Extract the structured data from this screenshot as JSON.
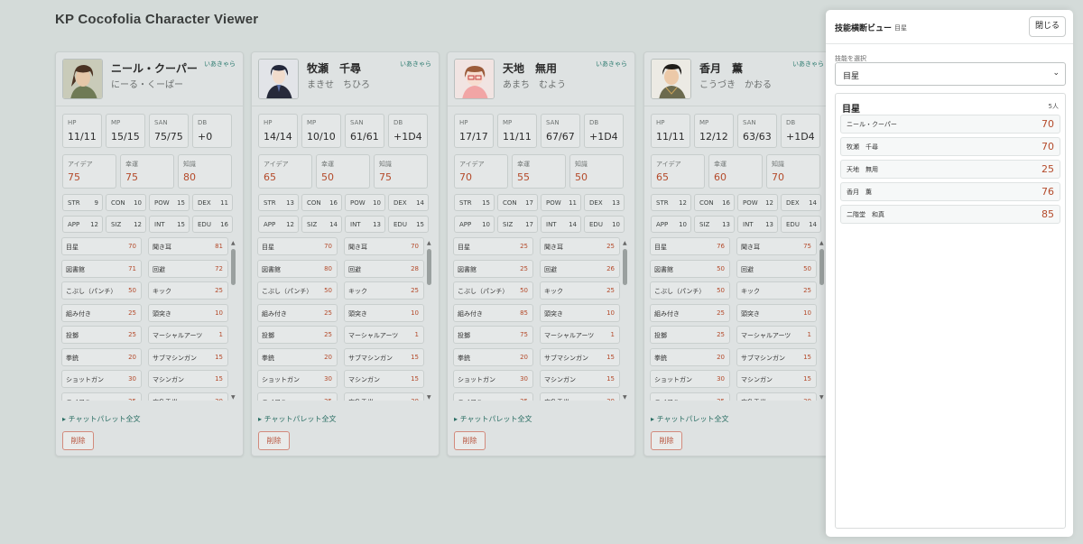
{
  "app": {
    "title": "KP Cocofolia Character Viewer"
  },
  "labels": {
    "hp": "HP",
    "mp": "MP",
    "san": "SAN",
    "db": "DB",
    "idea": "アイデア",
    "luck": "幸運",
    "know": "知識",
    "chat_palette": "チャットパレット全文",
    "delete": "削除"
  },
  "characters": [
    {
      "name": "ニール・クーパー",
      "kana": "にーる・くーぱー",
      "owner": "いあきゃら",
      "hp": "11/11",
      "mp": "15/15",
      "san": "75/75",
      "db": "+0",
      "idea": "75",
      "luck": "75",
      "know": "80",
      "attrs": [
        [
          "STR",
          "9"
        ],
        [
          "CON",
          "10"
        ],
        [
          "POW",
          "15"
        ],
        [
          "DEX",
          "11"
        ],
        [
          "APP",
          "12"
        ],
        [
          "SIZ",
          "12"
        ],
        [
          "INT",
          "15"
        ],
        [
          "EDU",
          "16"
        ]
      ],
      "skills": [
        [
          "目星",
          "70"
        ],
        [
          "聞き耳",
          "81"
        ],
        [
          "図書館",
          "71"
        ],
        [
          "回避",
          "72"
        ],
        [
          "こぶし（パンチ）",
          "50"
        ],
        [
          "キック",
          "25"
        ],
        [
          "組み付き",
          "25"
        ],
        [
          "頭突き",
          "10"
        ],
        [
          "投擲",
          "25"
        ],
        [
          "マーシャルアーツ",
          "1"
        ],
        [
          "拳銃",
          "20"
        ],
        [
          "サブマシンガン",
          "15"
        ],
        [
          "ショットガン",
          "30"
        ],
        [
          "マシンガン",
          "15"
        ],
        [
          "ライフル",
          "25"
        ],
        [
          "応急手当",
          "30"
        ]
      ]
    },
    {
      "name": "牧瀬　千尋",
      "kana": "まきせ　ちひろ",
      "owner": "いあきゃら",
      "hp": "14/14",
      "mp": "10/10",
      "san": "61/61",
      "db": "+1D4",
      "idea": "65",
      "luck": "50",
      "know": "75",
      "attrs": [
        [
          "STR",
          "13"
        ],
        [
          "CON",
          "16"
        ],
        [
          "POW",
          "10"
        ],
        [
          "DEX",
          "14"
        ],
        [
          "APP",
          "12"
        ],
        [
          "SIZ",
          "14"
        ],
        [
          "INT",
          "13"
        ],
        [
          "EDU",
          "15"
        ]
      ],
      "skills": [
        [
          "目星",
          "70"
        ],
        [
          "聞き耳",
          "70"
        ],
        [
          "図書館",
          "80"
        ],
        [
          "回避",
          "28"
        ],
        [
          "こぶし（パンチ）",
          "50"
        ],
        [
          "キック",
          "25"
        ],
        [
          "組み付き",
          "25"
        ],
        [
          "頭突き",
          "10"
        ],
        [
          "投擲",
          "25"
        ],
        [
          "マーシャルアーツ",
          "1"
        ],
        [
          "拳銃",
          "20"
        ],
        [
          "サブマシンガン",
          "15"
        ],
        [
          "ショットガン",
          "30"
        ],
        [
          "マシンガン",
          "15"
        ],
        [
          "ライフル",
          "25"
        ],
        [
          "応急手当",
          "30"
        ]
      ]
    },
    {
      "name": "天地　無用",
      "kana": "あまち　むよう",
      "owner": "いあきゃら",
      "hp": "17/17",
      "mp": "11/11",
      "san": "67/67",
      "db": "+1D4",
      "idea": "70",
      "luck": "55",
      "know": "50",
      "attrs": [
        [
          "STR",
          "15"
        ],
        [
          "CON",
          "17"
        ],
        [
          "POW",
          "11"
        ],
        [
          "DEX",
          "13"
        ],
        [
          "APP",
          "10"
        ],
        [
          "SIZ",
          "17"
        ],
        [
          "INT",
          "14"
        ],
        [
          "EDU",
          "10"
        ]
      ],
      "skills": [
        [
          "目星",
          "25"
        ],
        [
          "聞き耳",
          "25"
        ],
        [
          "図書館",
          "25"
        ],
        [
          "回避",
          "26"
        ],
        [
          "こぶし（パンチ）",
          "50"
        ],
        [
          "キック",
          "25"
        ],
        [
          "組み付き",
          "85"
        ],
        [
          "頭突き",
          "10"
        ],
        [
          "投擲",
          "75"
        ],
        [
          "マーシャルアーツ",
          "1"
        ],
        [
          "拳銃",
          "20"
        ],
        [
          "サブマシンガン",
          "15"
        ],
        [
          "ショットガン",
          "30"
        ],
        [
          "マシンガン",
          "15"
        ],
        [
          "ライフル",
          "25"
        ],
        [
          "応急手当",
          "30"
        ]
      ]
    },
    {
      "name": "香月　薫",
      "kana": "こうづき　かおる",
      "owner": "いあきゃら",
      "hp": "11/11",
      "mp": "12/12",
      "san": "63/63",
      "db": "+1D4",
      "idea": "65",
      "luck": "60",
      "know": "70",
      "attrs": [
        [
          "STR",
          "12"
        ],
        [
          "CON",
          "16"
        ],
        [
          "POW",
          "12"
        ],
        [
          "DEX",
          "14"
        ],
        [
          "APP",
          "10"
        ],
        [
          "SIZ",
          "13"
        ],
        [
          "INT",
          "13"
        ],
        [
          "EDU",
          "14"
        ]
      ],
      "skills": [
        [
          "目星",
          "76"
        ],
        [
          "聞き耳",
          "75"
        ],
        [
          "図書館",
          "50"
        ],
        [
          "回避",
          "50"
        ],
        [
          "こぶし（パンチ）",
          "50"
        ],
        [
          "キック",
          "25"
        ],
        [
          "組み付き",
          "25"
        ],
        [
          "頭突き",
          "10"
        ],
        [
          "投擲",
          "25"
        ],
        [
          "マーシャルアーツ",
          "1"
        ],
        [
          "拳銃",
          "20"
        ],
        [
          "サブマシンガン",
          "15"
        ],
        [
          "ショットガン",
          "30"
        ],
        [
          "マシンガン",
          "15"
        ],
        [
          "ライフル",
          "25"
        ],
        [
          "応急手当",
          "30"
        ]
      ]
    }
  ],
  "panel": {
    "title": "技能横断ビュー",
    "subtitle": "目星",
    "close_label": "閉じる",
    "select_label": "技能を選択",
    "selected_skill": "目星",
    "result_title": "目星",
    "result_count": "5人",
    "rows": [
      {
        "name": "ニール・クーパー",
        "value": "70"
      },
      {
        "name": "牧瀬　千尋",
        "value": "70"
      },
      {
        "name": "天地　無用",
        "value": "25"
      },
      {
        "name": "香月　薫",
        "value": "76"
      },
      {
        "name": "二階堂　和真",
        "value": "85"
      }
    ]
  },
  "colors": {
    "accent": "#2b7a6f",
    "value_red": "#b44a2a",
    "background": "#d4dbd9"
  }
}
